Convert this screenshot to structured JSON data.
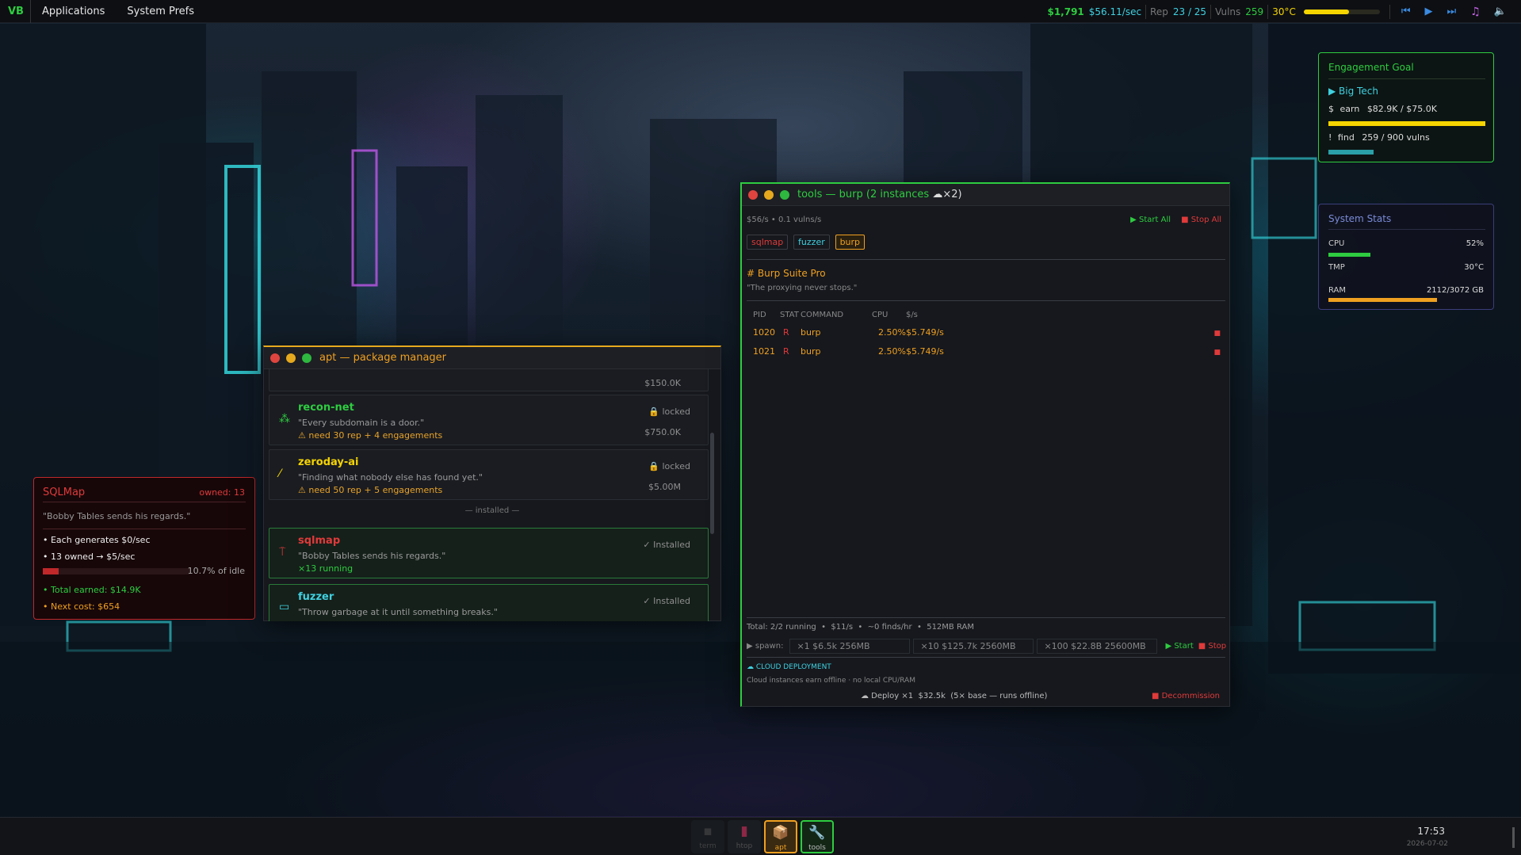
{
  "topbar": {
    "logo": "VB",
    "menu": [
      "Applications",
      "System Prefs"
    ],
    "money": "$1,791",
    "rate": "$56.11/sec",
    "rep_label": "Rep",
    "rep_value": "23 / 25",
    "vulns_label": "Vulns",
    "vulns_value": "259",
    "temp": "30°C",
    "progress": 0.6,
    "media_icons": [
      "prev-icon",
      "play-icon",
      "next-icon",
      "music-icon",
      "volume-icon"
    ]
  },
  "engagement": {
    "title": "Engagement Goal",
    "target": "▶ Big Tech",
    "earn_prefix": "$",
    "earn_label": "earn",
    "earn_value": "$82.9K / $75.0K",
    "earn_progress": 1.0,
    "find_prefix": "!",
    "find_label": "find",
    "find_value": "259 / 900 vulns",
    "find_progress": 0.29
  },
  "system_stats": {
    "title": "System Stats",
    "cpu_label": "CPU",
    "cpu_value": "52%",
    "cpu_progress": 0.27,
    "tmp_label": "TMP",
    "tmp_value": "30°C",
    "ram_label": "RAM",
    "ram_value": "2112/3072 GB",
    "ram_progress": 0.69
  },
  "sqlmap_card": {
    "title": "SQLMap",
    "owned": "owned: 13",
    "quote": "\"Bobby Tables sends his regards.\"",
    "line1": "• Each generates $0/sec",
    "line2": "• 13 owned → $5/sec",
    "idle_text": "10.7% of idle",
    "idle_progress": 0.107,
    "total": "• Total earned: $14.9K",
    "next_cost": "• Next cost: $654"
  },
  "apt": {
    "title": "apt — package manager",
    "top_price": "$150.0K",
    "packages": [
      {
        "name": "recon-net",
        "desc": "\"Every subdomain is a door.\"",
        "req": "need 30 rep + 4 engagements",
        "status": "locked",
        "price": "$750.0K"
      },
      {
        "name": "zeroday-ai",
        "desc": "\"Finding what nobody else has found yet.\"",
        "req": "need 50 rep + 5 engagements",
        "status": "locked",
        "price": "$5.00M"
      }
    ],
    "installed_divider": "— installed —",
    "installed": [
      {
        "name": "sqlmap",
        "desc": "\"Bobby Tables sends his regards.\"",
        "running": "×13 running",
        "status": "✓ Installed"
      },
      {
        "name": "fuzzer",
        "desc": "\"Throw garbage at it until something breaks.\"",
        "status": "✓ Installed"
      }
    ]
  },
  "tools": {
    "title": "tools — burp (2 instances",
    "title_cloud": "☁×2)",
    "rate": "$56/s",
    "vulns_rate": "0.1 vulns/s",
    "start_all": "▶ Start All",
    "stop_all": "■ Stop All",
    "tabs": [
      "sqlmap",
      "fuzzer",
      "burp"
    ],
    "heading": "# Burp Suite Pro",
    "tagline": "\"The proxying never stops.\"",
    "columns": [
      "PID",
      "STAT",
      "COMMAND",
      "CPU",
      "$/s"
    ],
    "processes": [
      {
        "pid": "1020",
        "stat": "R",
        "cmd": "burp",
        "cpu": "2.50%",
        "rate": "$5.749/s"
      },
      {
        "pid": "1021",
        "stat": "R",
        "cmd": "burp",
        "cpu": "2.50%",
        "rate": "$5.749/s"
      }
    ],
    "total": "Total: 2/2 running  •  $11/s  •  ~0 finds/hr  •  512MB RAM",
    "spawn_label": "▶ spawn:",
    "spawn_options": [
      "×1  $6.5k  256MB",
      "×10  $125.7k  2560MB",
      "×100  $22.8B  25600MB"
    ],
    "start": "▶ Start",
    "stop": "■ Stop",
    "cloud_heading": "☁  CLOUD DEPLOYMENT",
    "cloud_desc": "Cloud instances earn offline · no local CPU/RAM",
    "deploy": "☁ Deploy ×1  $32.5k  (5× base — runs offline)",
    "decommission": "■ Decommission"
  },
  "dock": {
    "items": [
      {
        "label": "term",
        "icon": "▪"
      },
      {
        "label": "htop",
        "icon": "▮"
      },
      {
        "label": "apt",
        "icon": "📦"
      },
      {
        "label": "tools",
        "icon": "🔧"
      }
    ],
    "time": "17:53",
    "date": "2026-07-02"
  },
  "colors": {
    "green": "#2ecc40",
    "cyan": "#3fd0e0",
    "yellow": "#f5d400",
    "orange": "#f0a020",
    "red": "#e03a3a"
  }
}
